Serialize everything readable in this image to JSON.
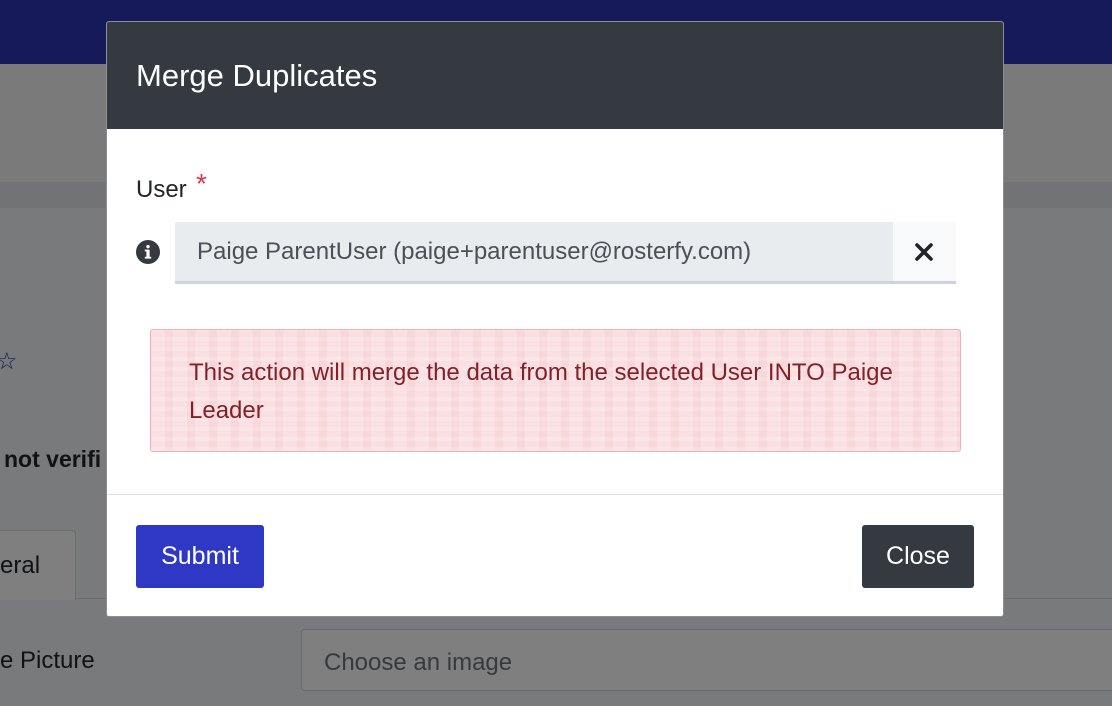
{
  "background": {
    "status_text": "not verifi",
    "tab_label": "eral",
    "picture_label": "e Picture",
    "file_input_placeholder": "Choose an image"
  },
  "modal": {
    "title": "Merge Duplicates",
    "field": {
      "label": "User",
      "required_marker": "*",
      "selected_value": "Paige ParentUser (paige+parentuser@rosterfy.com)"
    },
    "alert_text": "This action will merge the data from the selected User INTO Paige Leader",
    "submit_label": "Submit",
    "close_label": "Close"
  },
  "icons": {
    "info": "info-circle-icon",
    "clear": "close-icon",
    "star": "star-icon"
  },
  "colors": {
    "brand": "#2d35b4",
    "modal_header": "#343a40",
    "required": "#dc3545",
    "alert_bg": "#f8d7da",
    "alert_text": "#842029",
    "submit_bg": "#2f38c4",
    "close_bg": "#343a40"
  }
}
